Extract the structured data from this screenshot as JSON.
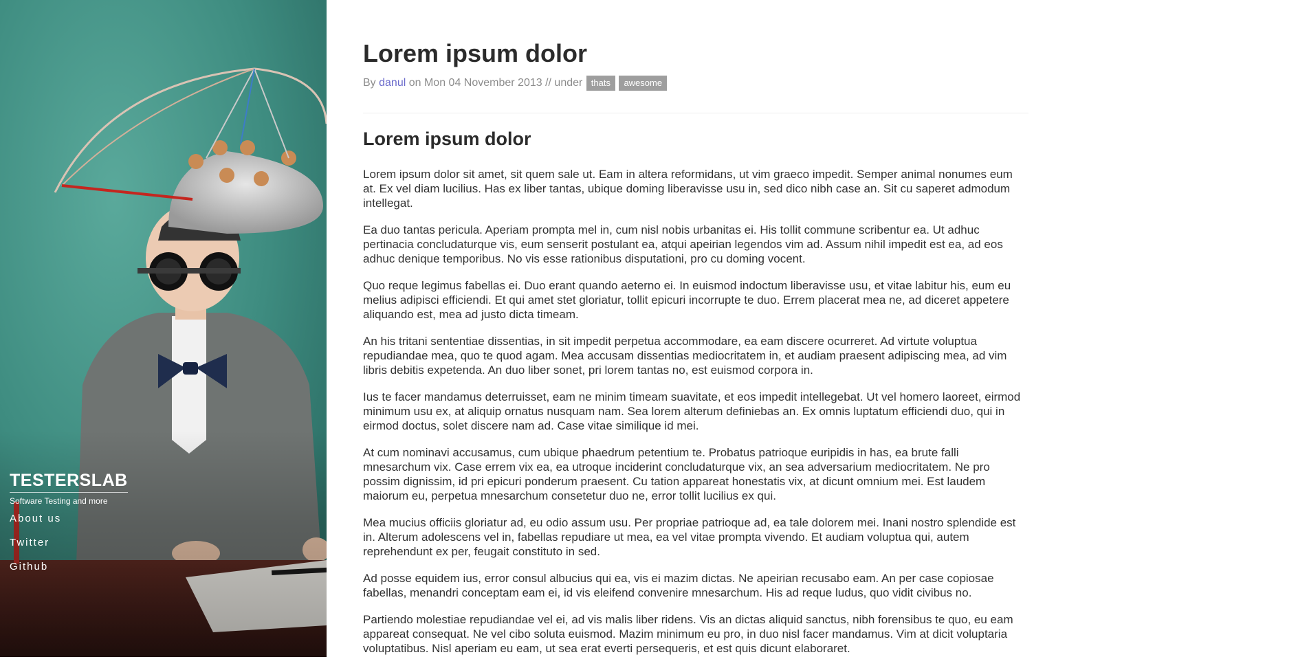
{
  "sidebar": {
    "site_title": "TESTERSLAB",
    "tagline": "Software Testing and more",
    "nav": [
      {
        "label": "About us"
      },
      {
        "label": "Twitter"
      },
      {
        "label": "Github"
      }
    ]
  },
  "post": {
    "title": "Lorem ipsum dolor",
    "meta": {
      "by": "By",
      "author": "danul",
      "on_date": "on Mon 04 November 2013 // under",
      "tags": [
        "thats",
        "awesome"
      ]
    },
    "heading": "Lorem ipsum dolor",
    "paragraphs": [
      "Lorem ipsum dolor sit amet, sit quem sale ut. Eam in altera reformidans, ut vim graeco impedit. Semper animal nonumes eum at. Ex vel diam lucilius. Has ex liber tantas, ubique doming liberavisse usu in, sed dico nibh case an. Sit cu saperet admodum intellegat.",
      "Ea duo tantas pericula. Aperiam prompta mel in, cum nisl nobis urbanitas ei. His tollit commune scribentur ea. Ut adhuc pertinacia concludaturque vis, eum senserit postulant ea, atqui apeirian legendos vim ad. Assum nihil impedit est ea, ad eos adhuc denique temporibus. No vis esse rationibus disputationi, pro cu doming vocent.",
      "Quo reque legimus fabellas ei. Duo erant quando aeterno ei. In euismod indoctum liberavisse usu, et vitae labitur his, eum eu melius adipisci efficiendi. Et qui amet stet gloriatur, tollit epicuri incorrupte te duo. Errem placerat mea ne, ad diceret appetere aliquando est, mea ad justo dicta timeam.",
      "An his tritani sententiae dissentias, in sit impedit perpetua accommodare, ea eam discere ocurreret. Ad virtute voluptua repudiandae mea, quo te quod agam. Mea accusam dissentias mediocritatem in, et audiam praesent adipiscing mea, ad vim libris debitis expetenda. An duo liber sonet, pri lorem tantas no, est euismod corpora in.",
      "Ius te facer mandamus deterruisset, eam ne minim timeam suavitate, et eos impedit intellegebat. Ut vel homero laoreet, eirmod minimum usu ex, at aliquip ornatus nusquam nam. Sea lorem alterum definiebas an. Ex omnis luptatum efficiendi duo, qui in eirmod doctus, solet discere nam ad. Case vitae similique id mei.",
      "At cum nominavi accusamus, cum ubique phaedrum petentium te. Probatus patrioque euripidis in has, ea brute falli mnesarchum vix. Case errem vix ea, ea utroque inciderint concludaturque vix, an sea adversarium mediocritatem. Ne pro possim dignissim, id pri epicuri ponderum praesent. Cu tation appareat honestatis vix, at dicunt omnium mei. Est laudem maiorum eu, perpetua mnesarchum consetetur duo ne, error tollit lucilius ex qui.",
      "Mea mucius officiis gloriatur ad, eu odio assum usu. Per propriae patrioque ad, ea tale dolorem mei. Inani nostro splendide est in. Alterum adolescens vel in, fabellas repudiare ut mea, ea vel vitae prompta vivendo. Et audiam voluptua qui, autem reprehendunt ex per, feugait constituto in sed.",
      "Ad posse equidem ius, error consul albucius qui ea, vis ei mazim dictas. Ne apeirian recusabo eam. An per case copiosae fabellas, menandri conceptam eam ei, id vis eleifend convenire mnesarchum. His ad reque ludus, quo vidit civibus no.",
      "Partiendo molestiae repudiandae vel ei, ad vis malis liber ridens. Vis an dictas aliquid sanctus, nibh forensibus te quo, eu eam appareat consequat. Ne vel cibo soluta euismod. Mazim minimum eu pro, in duo nisl facer mandamus. Vim at dicit voluptaria voluptatibus. Nisl aperiam eu eam, ut sea erat everti persequeris, et est quis dicunt elaboraret."
    ]
  },
  "colors": {
    "sidebar_bg": "#3f8f84",
    "author_link": "#6a6acb",
    "tag_bg": "#9e9e9e",
    "text": "#333333"
  }
}
